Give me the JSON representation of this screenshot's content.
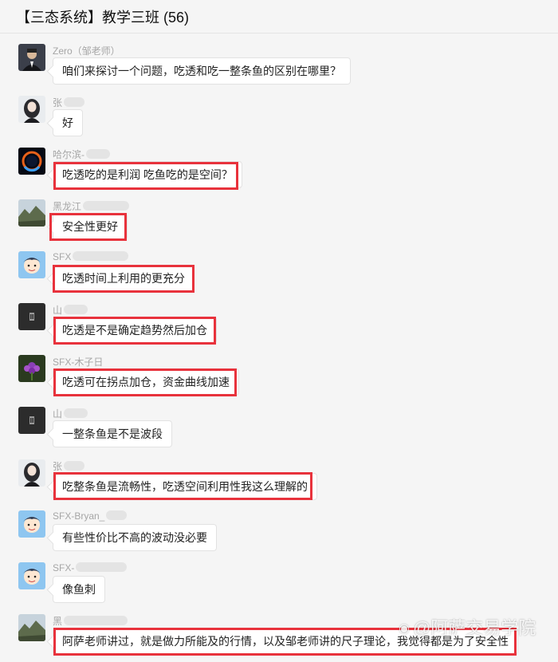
{
  "header": {
    "title": "【三态系统】教学三班 (56)"
  },
  "messages": [
    {
      "sender": "Zero（邹老师）",
      "text": "咱们来探讨一个问题，吃透和吃一整条鱼的区别在哪里？",
      "avatar": "man-suit-avatar",
      "highlighted": false
    },
    {
      "sender": "张",
      "text": "好",
      "avatar": "woman-portrait-avatar",
      "highlighted": false
    },
    {
      "sender": "哈尔滨-",
      "text": "吃透吃的是利润 吃鱼吃的是空间？",
      "avatar": "planet-ring-avatar",
      "highlighted": true
    },
    {
      "sender": "黑龙江",
      "text": "安全性更好",
      "avatar": "landscape-avatar",
      "highlighted": true
    },
    {
      "sender": "SFX",
      "text": "吃透时间上利用的更充分",
      "avatar": "cartoon-boy-avatar",
      "highlighted": true
    },
    {
      "sender": "山",
      "text": "吃透是不是确定趋势然后加仓",
      "avatar": "dark-logo-avatar",
      "highlighted": true
    },
    {
      "sender": "SFX-木子日",
      "text": "吃透可在拐点加仓，资金曲线加速",
      "avatar": "purple-flower-avatar",
      "highlighted": true
    },
    {
      "sender": "山",
      "text": "一整条鱼是不是波段",
      "avatar": "dark-logo-avatar",
      "highlighted": false
    },
    {
      "sender": "张",
      "text": "吃整条鱼是流畅性，吃透空间利用性我这么理解的",
      "avatar": "woman-portrait-avatar",
      "highlighted": true
    },
    {
      "sender": "SFX-Bryan_",
      "text": "有些性价比不高的波动没必要",
      "avatar": "cartoon-boy-avatar",
      "highlighted": false
    },
    {
      "sender": "SFX-",
      "text": "像鱼刺",
      "avatar": "cartoon-boy-avatar",
      "highlighted": false
    },
    {
      "sender": "黑",
      "text": "阿萨老师讲过，就是做力所能及的行情，以及邹老师讲的尺子理论，我觉得都是为了安全性",
      "avatar": "landscape-avatar",
      "highlighted": true
    }
  ],
  "watermark": {
    "text": "@阿萨交易学院",
    "logo": "weibo-logo-icon"
  },
  "colors": {
    "highlight": "#e8323c",
    "background": "#f5f5f5",
    "bubble": "#ffffff",
    "sender": "#a6a6a6"
  }
}
